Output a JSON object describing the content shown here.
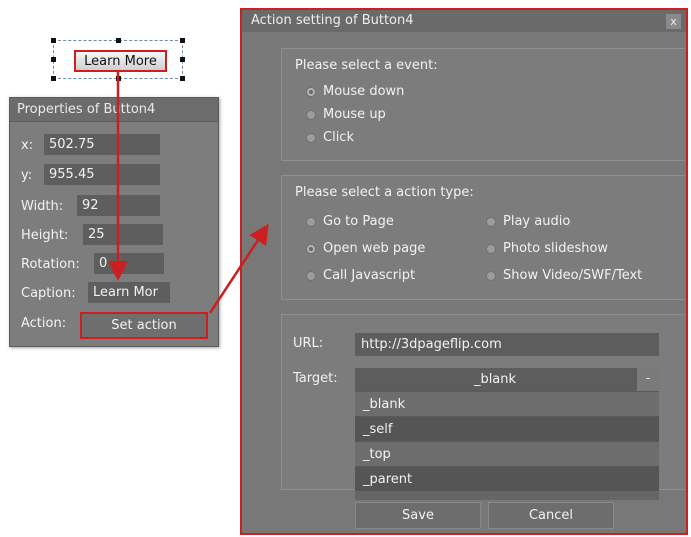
{
  "canvas_button": {
    "label": "Learn More"
  },
  "properties": {
    "title": "Properties of Button4",
    "fields": [
      {
        "label": "x:",
        "value": "502.75"
      },
      {
        "label": "y:",
        "value": "955.45"
      },
      {
        "label": "Width:",
        "value": "92"
      },
      {
        "label": "Height:",
        "value": "25"
      },
      {
        "label": "Rotation:",
        "value": "0"
      },
      {
        "label": "Caption:",
        "value": "Learn Mor"
      }
    ],
    "action_label": "Action:",
    "set_action_label": "Set action"
  },
  "dialog": {
    "title": "Action setting of Button4",
    "close_label": "x",
    "event_group": {
      "label": "Please select a event:",
      "options": [
        "Mouse down",
        "Mouse up",
        "Click"
      ]
    },
    "action_group": {
      "label": "Please select a action type:",
      "options": [
        "Go to Page",
        "Open web page",
        "Call Javascript",
        "Play audio",
        "Photo slideshow",
        "Show Video/SWF/Text"
      ]
    },
    "url_label": "URL:",
    "url_value": "http://3dpageflip.com",
    "target_label": "Target:",
    "target_value": "_blank",
    "target_arrow": "-",
    "target_options": [
      "_blank",
      "_self",
      "_top",
      "_parent"
    ],
    "save_label": "Save",
    "cancel_label": "Cancel"
  },
  "colors": {
    "highlight": "#cc1f1f",
    "panel_bg": "#7d7d7d",
    "dialog_bg": "#787878"
  }
}
